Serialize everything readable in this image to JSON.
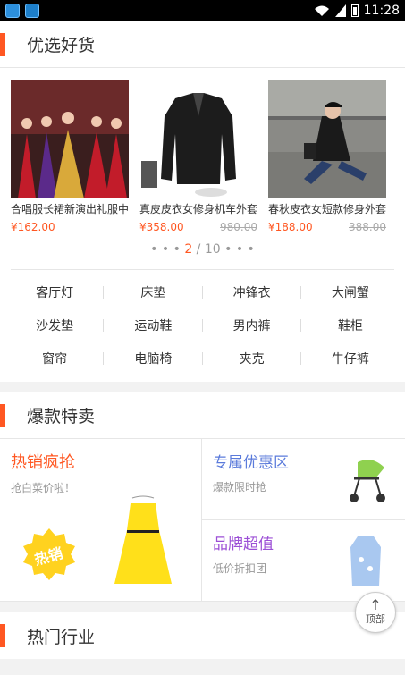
{
  "status_bar": {
    "time": "11:28"
  },
  "section1": {
    "title": "优选好货"
  },
  "products": [
    {
      "name": "合唱服长裙新演出礼服中...",
      "price": "¥162.00",
      "old_price": ""
    },
    {
      "name": "真皮皮衣女修身机车外套...",
      "price": "¥358.00",
      "old_price": "980.00"
    },
    {
      "name": "春秋皮衣女短款修身外套...",
      "price": "¥188.00",
      "old_price": "388.00"
    }
  ],
  "pager": {
    "left_dots": "• • •",
    "current": "2",
    "sep_total": " / 10",
    "right_dots": "• • •"
  },
  "categories": [
    "客厅灯",
    "床垫",
    "冲锋衣",
    "大闸蟹",
    "沙发垫",
    "运动鞋",
    "男内裤",
    "鞋柜",
    "窗帘",
    "电脑椅",
    "夹克",
    "牛仔裤"
  ],
  "section2": {
    "title": "爆款特卖"
  },
  "hot_left": {
    "title": "热销疯抢",
    "subtitle": "抢白菜价啦！",
    "badge": "热销"
  },
  "hot_right": [
    {
      "title": "专属优惠区",
      "subtitle": "爆款限时抢"
    },
    {
      "title": "品牌超值",
      "subtitle": "低价折扣团"
    }
  ],
  "section3": {
    "title": "热门行业"
  },
  "top_button": {
    "label": "顶部",
    "arrow": "↑"
  },
  "colors": {
    "accent": "#ff5722",
    "blue": "#5b7bdb",
    "purple": "#9c4fd6"
  }
}
